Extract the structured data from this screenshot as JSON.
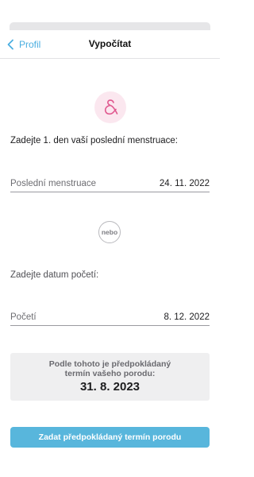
{
  "navbar": {
    "back_label": "Profil",
    "title": "Vypočítat"
  },
  "logo": {
    "icon": "ampersand-logo-icon",
    "color": "#e0588f"
  },
  "last_period": {
    "prompt": "Zadejte 1. den vaší poslední menstruace:",
    "label": "Poslední menstruace",
    "value": "24. 11. 2022"
  },
  "separator": {
    "text": "nebo"
  },
  "conception": {
    "prompt": "Zadejte datum početí:",
    "label": "Početí",
    "value": "8. 12. 2022"
  },
  "result": {
    "text": "Podle tohoto je předpokládaný termín vašeho porodu:",
    "date": "31. 8. 2023"
  },
  "submit": {
    "label": "Zadat předpokládaný termín porodu"
  },
  "colors": {
    "accent": "#4aaee0",
    "button": "#58b6dc",
    "logo_bg": "#fbe7ef"
  }
}
